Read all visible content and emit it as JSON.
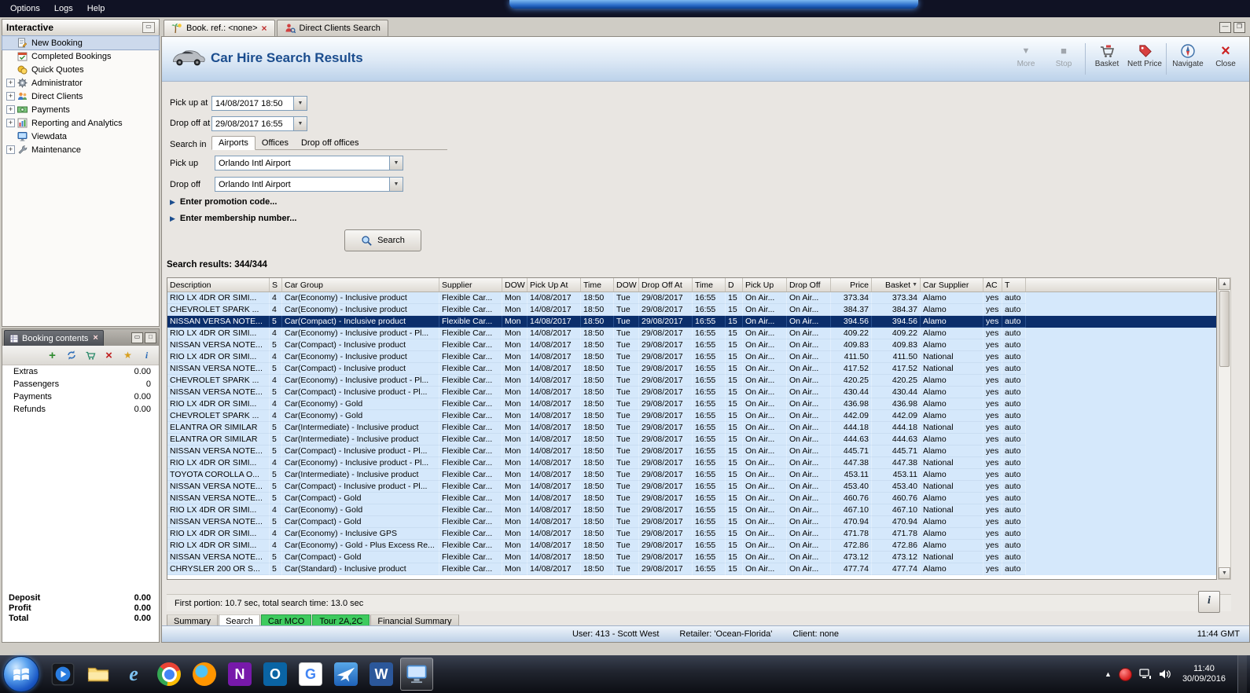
{
  "menubar": {
    "items": [
      {
        "label": "Options"
      },
      {
        "label": "Logs"
      },
      {
        "label": "Help"
      }
    ]
  },
  "sidebar": {
    "title": "Interactive",
    "items": [
      {
        "label": "New Booking",
        "icon": "new-booking-icon",
        "selected": true
      },
      {
        "label": "Completed Bookings",
        "icon": "completed-bookings-icon"
      },
      {
        "label": "Quick Quotes",
        "icon": "quick-quotes-icon"
      },
      {
        "label": "Administrator",
        "icon": "administrator-icon",
        "expandable": true
      },
      {
        "label": "Direct Clients",
        "icon": "direct-clients-icon",
        "expandable": true
      },
      {
        "label": "Payments",
        "icon": "payments-icon",
        "expandable": true
      },
      {
        "label": "Reporting and Analytics",
        "icon": "reporting-icon",
        "expandable": true
      },
      {
        "label": "Viewdata",
        "icon": "viewdata-icon"
      },
      {
        "label": "Maintenance",
        "icon": "maintenance-icon",
        "expandable": true
      }
    ]
  },
  "booking_contents": {
    "title": "Booking contents",
    "toolbar": [
      {
        "icon": "add-icon"
      },
      {
        "icon": "refresh-icon"
      },
      {
        "icon": "transfer-icon"
      },
      {
        "icon": "delete-icon"
      },
      {
        "icon": "wizard-icon"
      },
      {
        "icon": "info-icon"
      }
    ],
    "items": [
      {
        "label": "Extras",
        "value": "0.00"
      },
      {
        "label": "Passengers",
        "value": "0"
      },
      {
        "label": "Payments",
        "value": "0.00"
      },
      {
        "label": "Refunds",
        "value": "0.00"
      }
    ],
    "totals": [
      {
        "label": "Deposit",
        "value": "0.00"
      },
      {
        "label": "Profit",
        "value": "0.00"
      },
      {
        "label": "Total",
        "value": "0.00"
      }
    ]
  },
  "doc_tabs": [
    {
      "label": "Book. ref.: <none>",
      "icon": "palm-icon",
      "closable": true,
      "active": true
    },
    {
      "label": "Direct Clients Search",
      "icon": "client-search-icon"
    }
  ],
  "header": {
    "title": "Car Hire Search Results",
    "tools": [
      {
        "label": "More",
        "icon": "more-icon",
        "disabled": true
      },
      {
        "label": "Stop",
        "icon": "stop-icon",
        "disabled": true
      },
      {
        "label": "Basket",
        "icon": "basket-icon"
      },
      {
        "label": "Nett Price",
        "icon": "nett-price-icon"
      },
      {
        "label": "Navigate",
        "icon": "navigate-icon"
      },
      {
        "label": "Close",
        "icon": "close-icon"
      }
    ]
  },
  "form": {
    "pickup_at_label": "Pick up at",
    "pickup_at_value": "14/08/2017 18:50",
    "dropoff_at_label": "Drop off at",
    "dropoff_at_value": "29/08/2017 16:55",
    "search_in_label": "Search in",
    "search_in_tabs": [
      {
        "label": "Airports",
        "active": true
      },
      {
        "label": "Offices"
      },
      {
        "label": "Drop off offices"
      }
    ],
    "pickup_label": "Pick up",
    "pickup_value": "Orlando Intl Airport",
    "dropoff_label": "Drop off",
    "dropoff_value": "Orlando Intl Airport",
    "promo_label": "Enter promotion code...",
    "membership_label": "Enter membership number...",
    "search_button_label": "Search"
  },
  "results": {
    "summary": "Search results: 344/344",
    "columns": [
      {
        "label": "Description"
      },
      {
        "label": "S"
      },
      {
        "label": "Car Group"
      },
      {
        "label": "Supplier"
      },
      {
        "label": "DOW"
      },
      {
        "label": "Pick Up At"
      },
      {
        "label": "Time"
      },
      {
        "label": "DOW"
      },
      {
        "label": "Drop Off At"
      },
      {
        "label": "Time"
      },
      {
        "label": "D"
      },
      {
        "label": "Pick Up"
      },
      {
        "label": "Drop Off"
      },
      {
        "label": "Price",
        "num": true
      },
      {
        "label": "Basket",
        "num": true,
        "sort": "desc"
      },
      {
        "label": "Car Supplier"
      },
      {
        "label": "AC"
      },
      {
        "label": "T"
      }
    ],
    "common": {
      "supplier": "Flexible Car...",
      "dow_pick": "Mon",
      "pickup_date": "14/08/2017",
      "pickup_time": "18:50",
      "dow_drop": "Tue",
      "dropoff_date": "29/08/2017",
      "dropoff_time": "16:55",
      "days": "15",
      "pickup_loc": "On Air...",
      "dropoff_loc": "On Air...",
      "ac": "yes",
      "t": "auto"
    },
    "rows": [
      {
        "description": "RIO LX 4DR OR SIMI...",
        "seats": "4",
        "car_group": "Car(Economy) - Inclusive product",
        "price": "373.34",
        "basket": "373.34",
        "car_supplier": "Alamo"
      },
      {
        "description": "CHEVROLET SPARK ...",
        "seats": "4",
        "car_group": "Car(Economy) - Inclusive product",
        "price": "384.37",
        "basket": "384.37",
        "car_supplier": "Alamo"
      },
      {
        "description": "NISSAN VERSA NOTE...",
        "seats": "5",
        "car_group": "Car(Compact) - Inclusive product",
        "price": "394.56",
        "basket": "394.56",
        "car_supplier": "Alamo",
        "selected": true
      },
      {
        "description": "RIO LX 4DR OR SIMI...",
        "seats": "4",
        "car_group": "Car(Economy) - Inclusive product - Pl...",
        "price": "409.22",
        "basket": "409.22",
        "car_supplier": "Alamo"
      },
      {
        "description": "NISSAN VERSA NOTE...",
        "seats": "5",
        "car_group": "Car(Compact) - Inclusive product",
        "price": "409.83",
        "basket": "409.83",
        "car_supplier": "Alamo"
      },
      {
        "description": "RIO LX 4DR OR SIMI...",
        "seats": "4",
        "car_group": "Car(Economy) - Inclusive product",
        "price": "411.50",
        "basket": "411.50",
        "car_supplier": "National"
      },
      {
        "description": "NISSAN VERSA NOTE...",
        "seats": "5",
        "car_group": "Car(Compact) - Inclusive product",
        "price": "417.52",
        "basket": "417.52",
        "car_supplier": "National"
      },
      {
        "description": "CHEVROLET SPARK ...",
        "seats": "4",
        "car_group": "Car(Economy) - Inclusive product - Pl...",
        "price": "420.25",
        "basket": "420.25",
        "car_supplier": "Alamo"
      },
      {
        "description": "NISSAN VERSA NOTE...",
        "seats": "5",
        "car_group": "Car(Compact) - Inclusive product - Pl...",
        "price": "430.44",
        "basket": "430.44",
        "car_supplier": "Alamo"
      },
      {
        "description": "RIO LX 4DR OR SIMI...",
        "seats": "4",
        "car_group": "Car(Economy) - Gold",
        "price": "436.98",
        "basket": "436.98",
        "car_supplier": "Alamo"
      },
      {
        "description": "CHEVROLET SPARK ...",
        "seats": "4",
        "car_group": "Car(Economy) - Gold",
        "price": "442.09",
        "basket": "442.09",
        "car_supplier": "Alamo"
      },
      {
        "description": "ELANTRA OR SIMILAR",
        "seats": "5",
        "car_group": "Car(Intermediate) - Inclusive product",
        "price": "444.18",
        "basket": "444.18",
        "car_supplier": "National"
      },
      {
        "description": "ELANTRA OR SIMILAR",
        "seats": "5",
        "car_group": "Car(Intermediate) - Inclusive product",
        "price": "444.63",
        "basket": "444.63",
        "car_supplier": "Alamo"
      },
      {
        "description": "NISSAN VERSA NOTE...",
        "seats": "5",
        "car_group": "Car(Compact) - Inclusive product - Pl...",
        "price": "445.71",
        "basket": "445.71",
        "car_supplier": "Alamo"
      },
      {
        "description": "RIO LX 4DR OR SIMI...",
        "seats": "4",
        "car_group": "Car(Economy) - Inclusive product - Pl...",
        "price": "447.38",
        "basket": "447.38",
        "car_supplier": "National"
      },
      {
        "description": "TOYOTA COROLLA O...",
        "seats": "5",
        "car_group": "Car(Intermediate) - Inclusive product",
        "price": "453.11",
        "basket": "453.11",
        "car_supplier": "Alamo"
      },
      {
        "description": "NISSAN VERSA NOTE...",
        "seats": "5",
        "car_group": "Car(Compact) - Inclusive product - Pl...",
        "price": "453.40",
        "basket": "453.40",
        "car_supplier": "National"
      },
      {
        "description": "NISSAN VERSA NOTE...",
        "seats": "5",
        "car_group": "Car(Compact) - Gold",
        "price": "460.76",
        "basket": "460.76",
        "car_supplier": "Alamo"
      },
      {
        "description": "RIO LX 4DR OR SIMI...",
        "seats": "4",
        "car_group": "Car(Economy) - Gold",
        "price": "467.10",
        "basket": "467.10",
        "car_supplier": "National"
      },
      {
        "description": "NISSAN VERSA NOTE...",
        "seats": "5",
        "car_group": "Car(Compact) - Gold",
        "price": "470.94",
        "basket": "470.94",
        "car_supplier": "Alamo"
      },
      {
        "description": "RIO LX 4DR OR SIMI...",
        "seats": "4",
        "car_group": "Car(Economy) - Inclusive GPS",
        "price": "471.78",
        "basket": "471.78",
        "car_supplier": "Alamo"
      },
      {
        "description": "RIO LX 4DR OR SIMI...",
        "seats": "4",
        "car_group": "Car(Economy) - Gold - Plus Excess Re...",
        "price": "472.86",
        "basket": "472.86",
        "car_supplier": "Alamo"
      },
      {
        "description": "NISSAN VERSA NOTE...",
        "seats": "5",
        "car_group": "Car(Compact) - Gold",
        "price": "473.12",
        "basket": "473.12",
        "car_supplier": "National"
      },
      {
        "description": "CHRYSLER 200 OR S...",
        "seats": "5",
        "car_group": "Car(Standard) - Inclusive product",
        "price": "477.74",
        "basket": "477.74",
        "car_supplier": "Alamo"
      }
    ],
    "status": "First portion: 10.7 sec, total search time: 13.0 sec",
    "info_button_label": "i"
  },
  "bottom_tabs": [
    {
      "label": "Summary"
    },
    {
      "label": "Search",
      "active": true
    },
    {
      "label": "Car MCO",
      "green": true
    },
    {
      "label": "Tour 2A,2C",
      "green": true
    },
    {
      "label": "Financial Summary"
    }
  ],
  "statusbar": {
    "user": "User: 413 - Scott West",
    "retailer": "Retailer: 'Ocean-Florida'",
    "client": "Client: none",
    "time": "11:44 GMT"
  },
  "taskbar": {
    "icons": [
      {
        "name": "media-player-icon"
      },
      {
        "name": "explorer-icon"
      },
      {
        "name": "ie-icon"
      },
      {
        "name": "chrome-icon"
      },
      {
        "name": "firefox-icon"
      },
      {
        "name": "onenote-icon"
      },
      {
        "name": "outlook-icon"
      },
      {
        "name": "google-icon"
      },
      {
        "name": "travel-app-icon"
      },
      {
        "name": "word-icon"
      },
      {
        "name": "current-app-icon",
        "active": true
      }
    ],
    "clock": {
      "time": "11:40",
      "date": "30/09/2016"
    }
  },
  "colors": {
    "accent_blue": "#1b4d8e",
    "row_blue": "#d5e8fb",
    "selected_row": "#0b2e6b",
    "tab_green": "#3ecb5e"
  }
}
